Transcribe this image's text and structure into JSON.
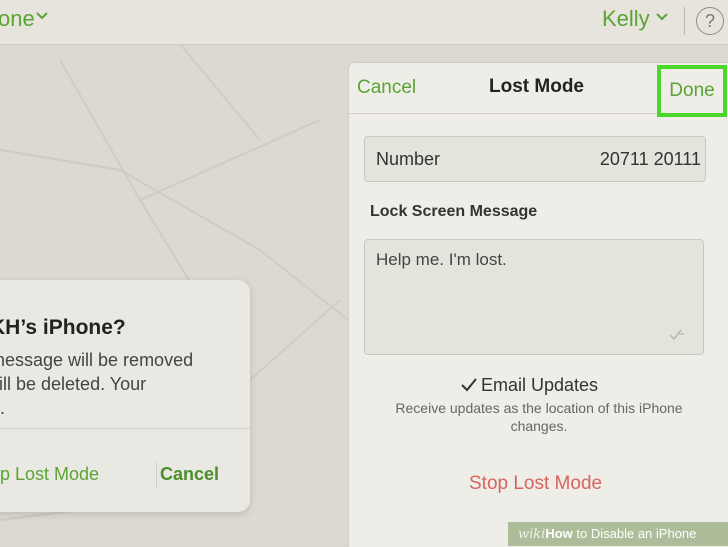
{
  "topbar": {
    "device_name": "one",
    "user_name": "Kelly",
    "help": "?"
  },
  "dialog": {
    "title": "KH’s iPhone?",
    "body_lines": [
      "message will be removed",
      "vill be deleted. Your",
      "d."
    ],
    "stop_button": "op Lost Mode",
    "cancel_button": "Cancel"
  },
  "panel": {
    "cancel": "Cancel",
    "title": "Lost Mode",
    "done": "Done",
    "number_label": "Number",
    "number_value": "20711 20111",
    "lock_label": "Lock Screen Message",
    "message": "Help me. I'm lost.",
    "email_updates": "Email Updates",
    "email_desc": "Receive updates as the location of this iPhone changes.",
    "stop_lost_mode": "Stop Lost Mode"
  },
  "watermark": {
    "wiki": "wiki",
    "how": "How",
    "rest": " to Disable an iPhone"
  },
  "colors": {
    "accent_green": "#5aa435",
    "done_highlight": "#49d82a",
    "stop_red": "#d9645f"
  },
  "icons": [
    "chevron-down-icon",
    "help-icon",
    "checkmark-icon",
    "spellcheck-icon"
  ]
}
